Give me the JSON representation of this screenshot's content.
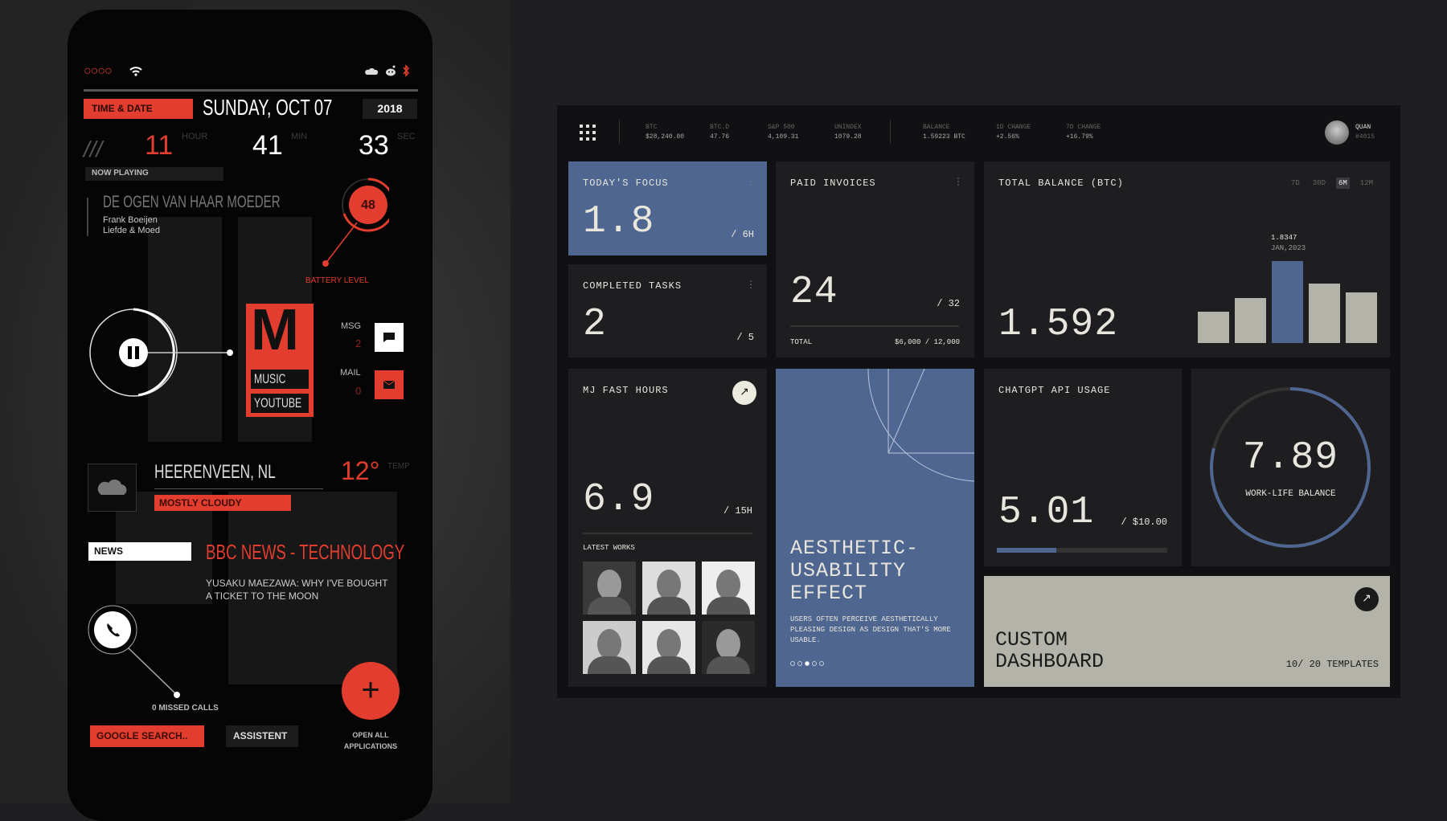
{
  "phone": {
    "status": {
      "signal_icon": "signal-dots-icon",
      "wifi_icon": "wifi-icon",
      "right_icons": [
        "cloud-icon",
        "reddit-icon",
        "bluetooth-icon"
      ]
    },
    "time_date_label": "TIME & DATE",
    "date": "SUNDAY, OCT 07",
    "year": "2018",
    "clock": {
      "slashes": "///",
      "hour": "11",
      "hour_label": "HOUR",
      "min": "41",
      "min_label": "MIN",
      "sec": "33",
      "sec_label": "SEC"
    },
    "now_playing_label": "NOW PLAYING",
    "song": "DE OGEN VAN HAAR MOEDER",
    "artist": "Frank Boeijen",
    "album": "Liefde & Moed",
    "battery": {
      "value": "48",
      "label": "BATTERY LEVEL"
    },
    "music_tile": {
      "letter": "M",
      "items": [
        "MUSIC",
        "YOUTUBE"
      ]
    },
    "msg": {
      "label": "MSG",
      "count": "2"
    },
    "mail": {
      "label": "MAIL",
      "count": "0"
    },
    "weather": {
      "city": "HEERENVEEN, NL",
      "condition": "MOSTLY CLOUDY",
      "temp": "12°",
      "temp_label": "TEMP"
    },
    "news": {
      "label": "NEWS",
      "source": "BBC NEWS - TECHNOLOGY",
      "headline1": "YUSAKU MAEZAWA: WHY I'VE BOUGHT",
      "headline2": "A TICKET TO THE MOON"
    },
    "missed_calls": "0 MISSED CALLS",
    "google": "GOOGLE SEARCH..",
    "assistent": "ASSISTENT",
    "open_all1": "OPEN ALL",
    "open_all2": "APPLICATIONS",
    "colors": {
      "accent": "#e23d2e",
      "bg": "#050505"
    }
  },
  "dash": {
    "header": {
      "tickers": [
        {
          "k": "BTC",
          "v": "$28,240.00"
        },
        {
          "k": "BTC.D",
          "v": "47.76"
        },
        {
          "k": "S&P 500",
          "v": "4,109.31"
        },
        {
          "k": "UNINDEX",
          "v": "1079.28"
        },
        {
          "k": "BALANCE",
          "v": "1.59223 BTC"
        },
        {
          "k": "1D CHANGE",
          "v": "+2.56%"
        },
        {
          "k": "7D CHANGE",
          "v": "+16.79%"
        }
      ],
      "user": "QUAN",
      "user_id": "#4015"
    },
    "focus": {
      "title": "TODAY'S FOCUS",
      "value": "1.8",
      "of": "/ 6H"
    },
    "tasks": {
      "title": "COMPLETED TASKS",
      "value": "2",
      "of": "/ 5"
    },
    "invoices": {
      "title": "PAID INVOICES",
      "value": "24",
      "of": "/ 32",
      "total_label": "TOTAL",
      "total": "$6,000 / 12,000"
    },
    "balance": {
      "title": "TOTAL BALANCE (BTC)",
      "value": "1.592",
      "ranges": [
        "7D",
        "30D",
        "6M",
        "12M"
      ],
      "active_range": "6M",
      "tooltip_value": "1.8347",
      "tooltip_date": "JAN,2023",
      "bar_levels": [
        0.38,
        0.55,
        1.0,
        0.73,
        0.62
      ],
      "highlight_index": 2
    },
    "mj": {
      "title": "MJ FAST HOURS",
      "value": "6.9",
      "of": "/ 15H",
      "latest": "LATEST WORKS"
    },
    "aesthetic": {
      "title1": "AESTHETIC-",
      "title2": "USABILITY",
      "title3": "EFFECT",
      "desc": "USERS OFTEN PERCEIVE AESTHETICALLY PLEASING DESIGN AS DESIGN THAT'S MORE USABLE.",
      "page_index": 2,
      "pages": 5
    },
    "chatgpt": {
      "title": "CHATGPT API USAGE",
      "value": "5.01",
      "of": "/ $10.00",
      "progress": 0.35
    },
    "wlb": {
      "value": "7.89",
      "label": "WORK-LIFE BALANCE",
      "progress": 0.789
    },
    "custom": {
      "title1": "CUSTOM",
      "title2": "DASHBOARD",
      "templates": "10/ 20 TEMPLATES"
    },
    "colors": {
      "blue": "#4f6690",
      "card": "#1e1e21",
      "beige": "#b4b3a9",
      "text": "#e8e6dc"
    }
  }
}
